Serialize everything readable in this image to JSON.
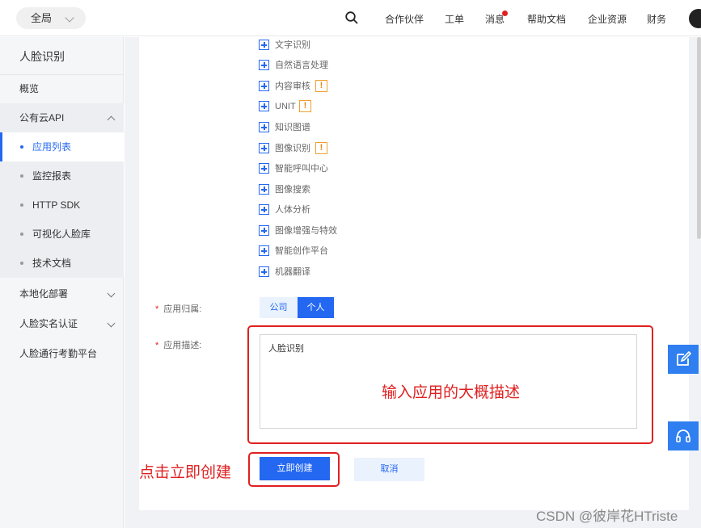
{
  "topbar": {
    "scope_label": "全局",
    "nav": [
      {
        "id": "partners",
        "label": "合作伙伴"
      },
      {
        "id": "tickets",
        "label": "工单"
      },
      {
        "id": "messages",
        "label": "消息"
      },
      {
        "id": "help",
        "label": "帮助文档"
      },
      {
        "id": "enterprise",
        "label": "企业资源"
      },
      {
        "id": "finance",
        "label": "财务"
      }
    ]
  },
  "sidebar": {
    "title": "人脸识别",
    "items": [
      {
        "label": "概览"
      },
      {
        "label": "公有云API"
      },
      {
        "label": "应用列表"
      },
      {
        "label": "监控报表"
      },
      {
        "label": "HTTP SDK"
      },
      {
        "label": "可视化人脸库"
      },
      {
        "label": "技术文档"
      },
      {
        "label": "本地化部署"
      },
      {
        "label": "人脸实名认证"
      },
      {
        "label": "人脸通行考勤平台"
      }
    ]
  },
  "form": {
    "services": [
      {
        "label": "文字识别"
      },
      {
        "label": "自然语言处理"
      },
      {
        "label": "内容审核",
        "warn": "!"
      },
      {
        "label": "UNIT",
        "warn": "!"
      },
      {
        "label": "知识图谱"
      },
      {
        "label": "图像识别",
        "warn": "!"
      },
      {
        "label": "智能呼叫中心"
      },
      {
        "label": "图像搜索"
      },
      {
        "label": "人体分析"
      },
      {
        "label": "图像增强与特效"
      },
      {
        "label": "智能创作平台"
      },
      {
        "label": "机器翻译"
      }
    ],
    "ownership_label": "应用归属:",
    "ownership_options": [
      "公司",
      "个人"
    ],
    "ownership_selected": "个人",
    "description_label": "应用描述:",
    "description_value": "人脸识别",
    "required_mark": "*",
    "create_button": "立即创建",
    "cancel_button": "取消"
  },
  "annotations": {
    "describe_hint": "输入应用的大概描述",
    "create_hint": "点击立即创建"
  },
  "watermark": "CSDN @彼岸花HTriste",
  "colors": {
    "accent": "#2468f2",
    "annotation": "#e02020",
    "warning": "#f0a030"
  }
}
